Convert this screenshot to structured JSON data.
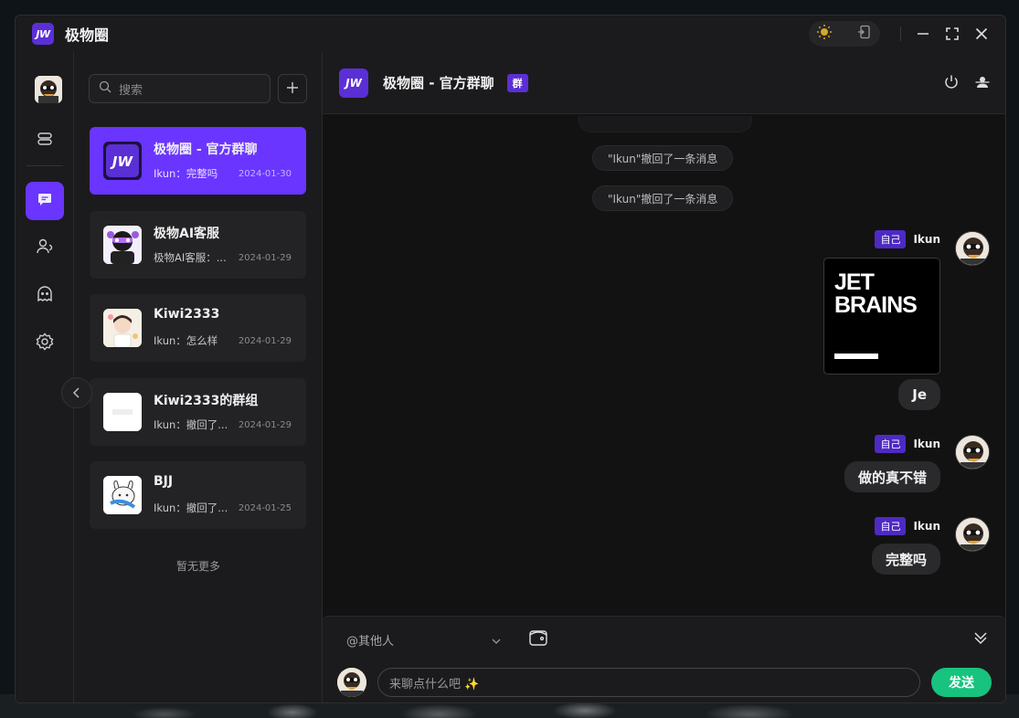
{
  "app": {
    "logo_text": "JW",
    "title": "极物圈"
  },
  "titlebar": {
    "theme_icon": "sun-icon",
    "pin_icon": "pin-window-icon",
    "minimize": "—",
    "maximize": "maximize-icon",
    "close": "close-icon"
  },
  "rail": {
    "items": [
      {
        "icon": "server-icon"
      },
      {
        "icon": "chat-icon",
        "active": true
      },
      {
        "icon": "contacts-icon"
      },
      {
        "icon": "ghost-icon"
      },
      {
        "icon": "gear-icon"
      }
    ]
  },
  "search": {
    "placeholder": "搜索"
  },
  "conversations": [
    {
      "name": "极物圈 - 官方群聊",
      "preview": "Ikun：完整吗",
      "date": "2024-01-30",
      "active": true
    },
    {
      "name": "极物AI客服",
      "preview": "极物AI客服：...",
      "date": "2024-01-29"
    },
    {
      "name": "Kiwi2333",
      "preview": "Ikun：怎么样",
      "date": "2024-01-29"
    },
    {
      "name": "Kiwi2333的群组",
      "preview": "Ikun：撤回了...",
      "date": "2024-01-29"
    },
    {
      "name": "BJJ",
      "preview": "Ikun：撤回了...",
      "date": "2024-01-25"
    }
  ],
  "list_footer": "暂无更多",
  "chat": {
    "title": "极物圈 - 官方群聊",
    "badge": "群",
    "system_messages": [
      "\"Ikun\"撤回了一条消息",
      "\"Ikun\"撤回了一条消息"
    ],
    "messages": [
      {
        "tag": "自己",
        "sender": "Ikun",
        "image_text": "JET\nBRAINS",
        "text": "Je"
      },
      {
        "tag": "自己",
        "sender": "Ikun",
        "text": "做的真不错"
      },
      {
        "tag": "自己",
        "sender": "Ikun",
        "text": "完整吗"
      }
    ]
  },
  "composer": {
    "mention_placeholder": "@其他人",
    "input_placeholder": "来聊点什么吧 ✨",
    "send_label": "发送"
  },
  "colors": {
    "accent": "#6a35ff",
    "send": "#17c37e",
    "bg": "#1b1b1d"
  }
}
